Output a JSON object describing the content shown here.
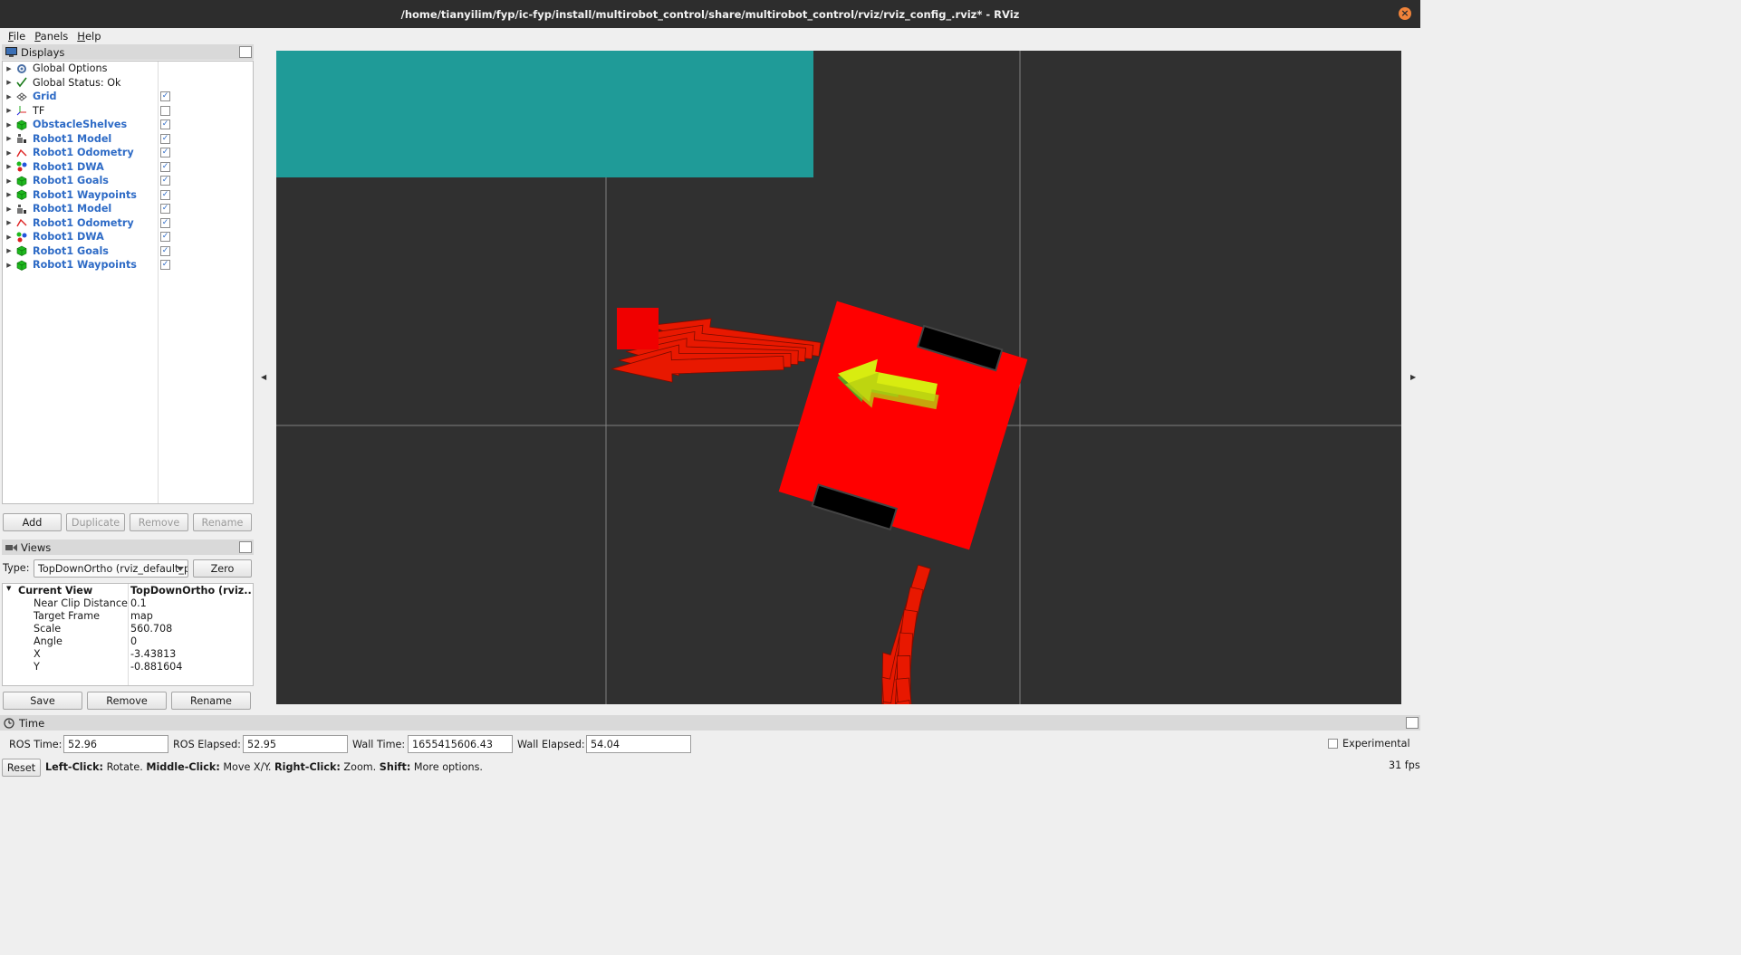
{
  "window": {
    "title": "/home/tianyilim/fyp/ic-fyp/install/multirobot_control/share/multirobot_control/rviz/rviz_config_.rviz* - RViz"
  },
  "menu": [
    "File",
    "Panels",
    "Help"
  ],
  "displays": {
    "title": "Displays",
    "items": [
      {
        "label": "Global Options",
        "icon": "gear-icon",
        "style": "plain",
        "checkbox": null
      },
      {
        "label": "Global Status: Ok",
        "icon": "checkmark-icon",
        "style": "plain",
        "checkbox": null
      },
      {
        "label": "Grid",
        "icon": "grid-icon",
        "style": "blue",
        "checkbox": true
      },
      {
        "label": "TF",
        "icon": "tf-axes-icon",
        "style": "plain",
        "checkbox": false
      },
      {
        "label": "ObstacleShelves",
        "icon": "marker-cube-icon",
        "style": "blue",
        "checkbox": true
      },
      {
        "label": "Robot1 Model",
        "icon": "robot-model-icon",
        "style": "blue",
        "checkbox": true
      },
      {
        "label": "Robot1 Odometry",
        "icon": "odometry-icon",
        "style": "blue",
        "checkbox": true
      },
      {
        "label": "Robot1 DWA",
        "icon": "marker-array-icon",
        "style": "blue",
        "checkbox": true
      },
      {
        "label": "Robot1 Goals",
        "icon": "marker-cube-icon",
        "style": "blue",
        "checkbox": true
      },
      {
        "label": "Robot1 Waypoints",
        "icon": "marker-cube-icon",
        "style": "blue",
        "checkbox": true
      },
      {
        "label": "Robot1 Model",
        "icon": "robot-model-icon",
        "style": "blue",
        "checkbox": true
      },
      {
        "label": "Robot1 Odometry",
        "icon": "odometry-icon",
        "style": "blue",
        "checkbox": true
      },
      {
        "label": "Robot1 DWA",
        "icon": "marker-array-icon",
        "style": "blue",
        "checkbox": true
      },
      {
        "label": "Robot1 Goals",
        "icon": "marker-cube-icon",
        "style": "blue",
        "checkbox": true
      },
      {
        "label": "Robot1 Waypoints",
        "icon": "marker-cube-icon",
        "style": "blue",
        "checkbox": true
      }
    ],
    "buttons": {
      "add": "Add",
      "duplicate": "Duplicate",
      "remove": "Remove",
      "rename": "Rename"
    }
  },
  "views": {
    "title": "Views",
    "type_label": "Type:",
    "type_value": "TopDownOrtho (rviz_default_plugins)",
    "zero": "Zero",
    "current_view": {
      "label": "Current View",
      "value": "TopDownOrtho (rviz..."
    },
    "properties": [
      {
        "k": "Near Clip Distance",
        "v": "0.1"
      },
      {
        "k": "Target Frame",
        "v": "map"
      },
      {
        "k": "Scale",
        "v": "560.708"
      },
      {
        "k": "Angle",
        "v": "0"
      },
      {
        "k": "X",
        "v": "-3.43813"
      },
      {
        "k": "Y",
        "v": "-0.881604"
      }
    ],
    "buttons": {
      "save": "Save",
      "remove": "Remove",
      "rename": "Rename"
    }
  },
  "time": {
    "title": "Time",
    "ros_time_label": "ROS Time:",
    "ros_time": "52.96",
    "ros_elapsed_label": "ROS Elapsed:",
    "ros_elapsed": "52.95",
    "wall_time_label": "Wall Time:",
    "wall_time": "1655415606.43",
    "wall_elapsed_label": "Wall Elapsed:",
    "wall_elapsed": "54.04",
    "experimental": "Experimental"
  },
  "status": {
    "reset": "Reset",
    "hint_parts": [
      {
        "b": "Left-Click:",
        "t": " Rotate. "
      },
      {
        "b": "Middle-Click:",
        "t": " Move X/Y. "
      },
      {
        "b": "Right-Click:",
        "t": " Zoom. "
      },
      {
        "b": "Shift:",
        "t": " More options."
      }
    ],
    "fps": "31 fps"
  },
  "colors": {
    "shelf": "#1f9b98",
    "robot": "#ff0000",
    "arrow_red": "#e81800",
    "arrow_yellow": "#d8ec10",
    "grid_line": "#808080",
    "link_blue": "#2e6bc6"
  }
}
